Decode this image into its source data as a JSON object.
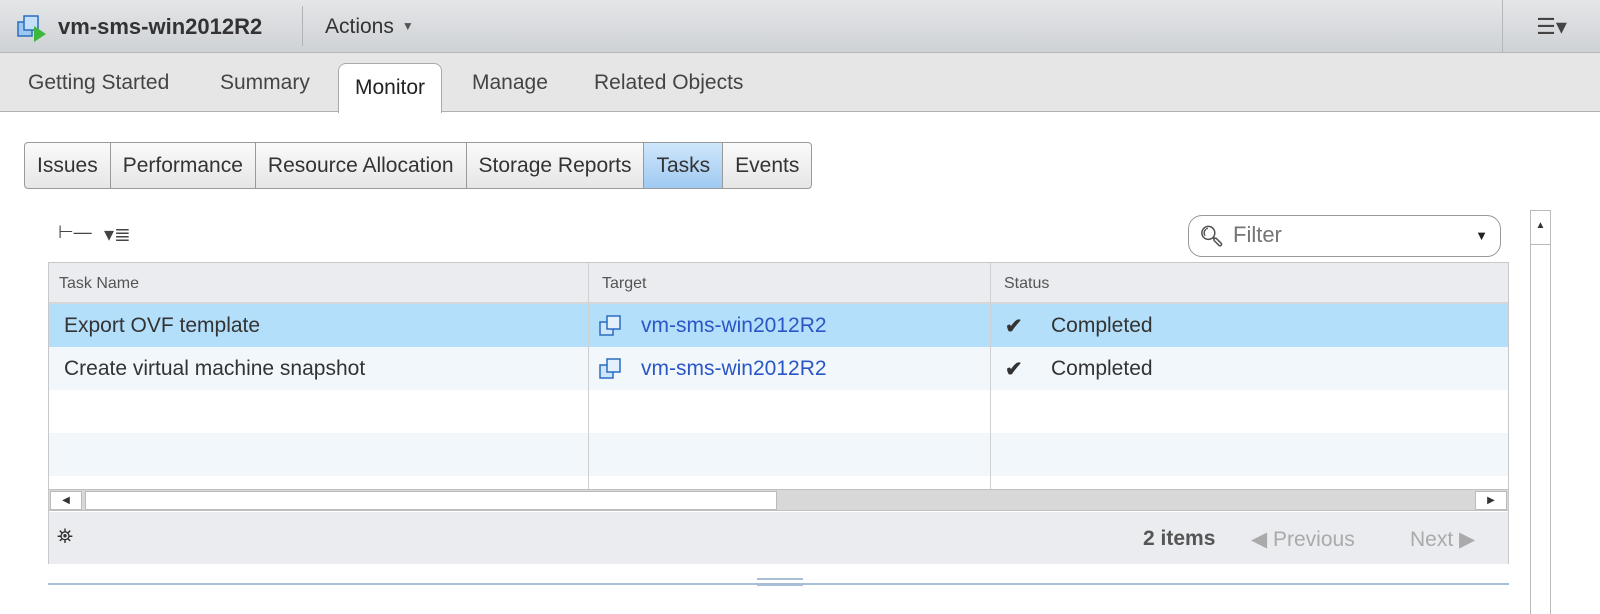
{
  "header": {
    "title": "vm-sms-win2012R2",
    "actions_label": "Actions"
  },
  "tabs": [
    "Getting Started",
    "Summary",
    "Monitor",
    "Manage",
    "Related Objects"
  ],
  "subtabs": [
    "Issues",
    "Performance",
    "Resource Allocation",
    "Storage Reports",
    "Tasks",
    "Events"
  ],
  "filter": {
    "placeholder": "Filter"
  },
  "table": {
    "columns": [
      "Task Name",
      "Target",
      "Status"
    ],
    "rows": [
      {
        "task": "Export OVF template",
        "target": "vm-sms-win2012R2",
        "status": "Completed"
      },
      {
        "task": "Create virtual machine snapshot",
        "target": "vm-sms-win2012R2",
        "status": "Completed"
      }
    ]
  },
  "footer": {
    "count": "2 items",
    "previous": "Previous",
    "next": "Next"
  },
  "colors": {
    "selected_row": "#b3dffb",
    "link": "#2a56c6",
    "check": "#3aa53a"
  }
}
